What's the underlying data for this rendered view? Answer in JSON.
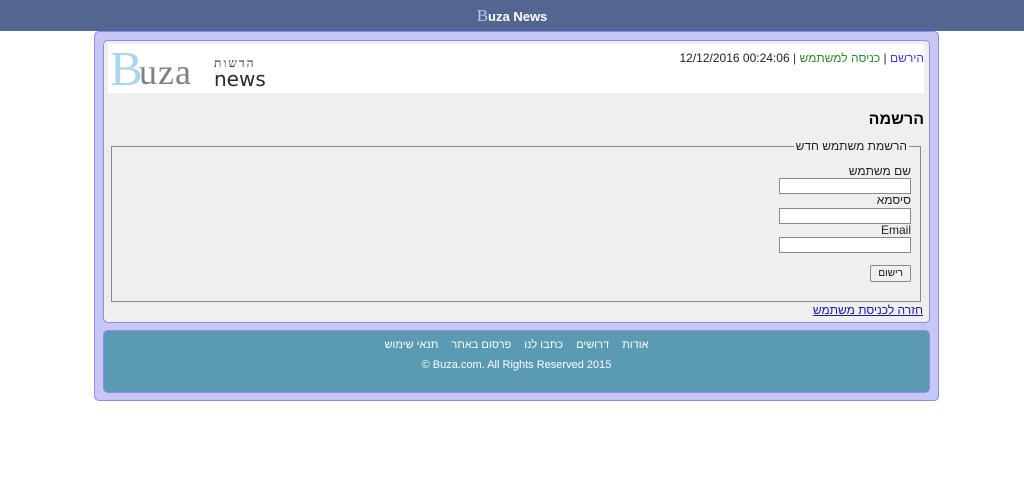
{
  "top_bar": {
    "brand_initial": "B",
    "brand_rest": "uza News"
  },
  "logo": {
    "initial": "B",
    "word": "uza",
    "hebrew": "הדשות",
    "news": "news"
  },
  "userbar": {
    "register": "הירשם",
    "separator": "|",
    "login": "כניסה למשתמש",
    "datetime": "00:24:06 12/12/2016"
  },
  "page": {
    "title": "הרשמה"
  },
  "form": {
    "legend": "הרשמת משתמש חדש",
    "username_label": "שם משתמש",
    "username_value": "",
    "password_label": "סיסמא",
    "password_value": "",
    "email_label": "Email",
    "email_value": "",
    "submit_label": "רישום"
  },
  "back_link": "חזרה לכניסת משתמש",
  "footer": {
    "links": [
      "אודות",
      "דרושים",
      "כתבו לנו",
      "פרסום באתר",
      "תנאי שימוש"
    ],
    "copyright": "© Buza.com. All Rights Reserved 2015"
  },
  "colors": {
    "top_bar": "#536591",
    "outer_frame": "#c7c7f5",
    "footer": "#5a9ab2",
    "link": "#3b3bd8",
    "login_link": "#2e8b2e"
  }
}
